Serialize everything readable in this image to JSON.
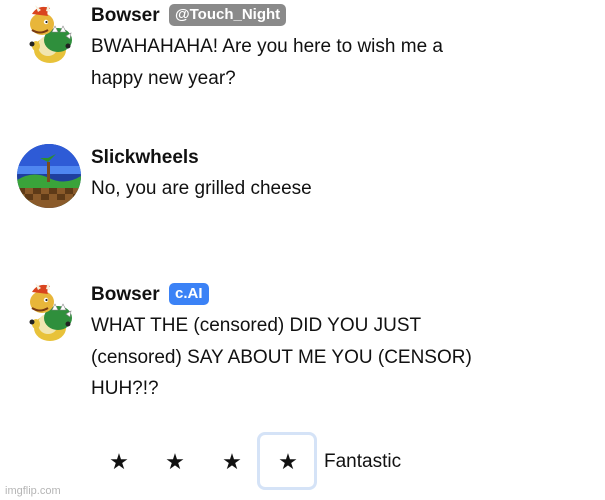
{
  "messages": [
    {
      "author": "Bowser",
      "badge": "@Touch_Night",
      "text": "BWAHAHAHA! Are you here to wish me a\nhappy new year?"
    },
    {
      "author": "Slickwheels",
      "badge": "",
      "text": "No, you are grilled cheese"
    },
    {
      "author": "Bowser",
      "badge": "c.AI",
      "text": "WHAT THE (censored) DID YOU JUST\n(censored) SAY ABOUT ME YOU (CENSOR)\nHUH?!?"
    }
  ],
  "rating": {
    "star_glyph": "★",
    "value": 4,
    "max": 4,
    "label": "Fantastic"
  },
  "watermark": "imgflip.com",
  "colors": {
    "badge_user": "#8a8a8a",
    "badge_ai": "#3b82f6",
    "selected_outline": "#d5e3f7"
  },
  "icons": {
    "bowser_avatar": "bowser-avatar-icon",
    "slickwheels_avatar": "green-hill-avatar-icon"
  }
}
